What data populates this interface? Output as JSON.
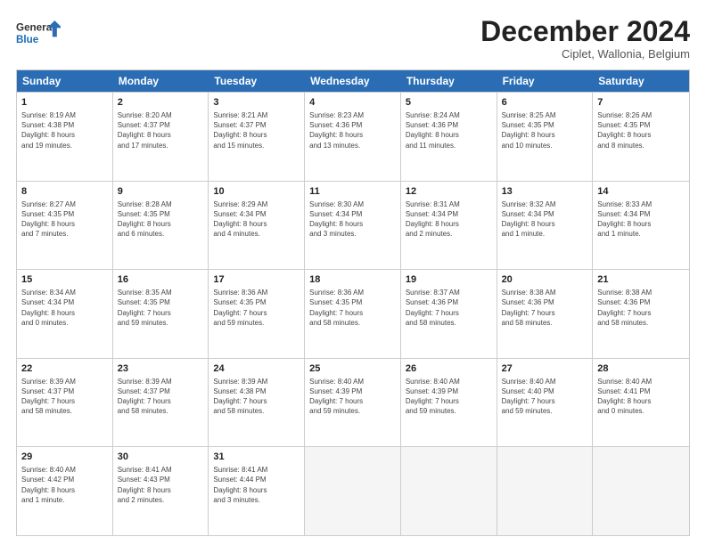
{
  "logo": {
    "line1": "General",
    "line2": "Blue"
  },
  "header": {
    "title": "December 2024",
    "subtitle": "Ciplet, Wallonia, Belgium"
  },
  "days": [
    "Sunday",
    "Monday",
    "Tuesday",
    "Wednesday",
    "Thursday",
    "Friday",
    "Saturday"
  ],
  "weeks": [
    [
      {
        "day": "1",
        "info": "Sunrise: 8:19 AM\nSunset: 4:38 PM\nDaylight: 8 hours\nand 19 minutes."
      },
      {
        "day": "2",
        "info": "Sunrise: 8:20 AM\nSunset: 4:37 PM\nDaylight: 8 hours\nand 17 minutes."
      },
      {
        "day": "3",
        "info": "Sunrise: 8:21 AM\nSunset: 4:37 PM\nDaylight: 8 hours\nand 15 minutes."
      },
      {
        "day": "4",
        "info": "Sunrise: 8:23 AM\nSunset: 4:36 PM\nDaylight: 8 hours\nand 13 minutes."
      },
      {
        "day": "5",
        "info": "Sunrise: 8:24 AM\nSunset: 4:36 PM\nDaylight: 8 hours\nand 11 minutes."
      },
      {
        "day": "6",
        "info": "Sunrise: 8:25 AM\nSunset: 4:35 PM\nDaylight: 8 hours\nand 10 minutes."
      },
      {
        "day": "7",
        "info": "Sunrise: 8:26 AM\nSunset: 4:35 PM\nDaylight: 8 hours\nand 8 minutes."
      }
    ],
    [
      {
        "day": "8",
        "info": "Sunrise: 8:27 AM\nSunset: 4:35 PM\nDaylight: 8 hours\nand 7 minutes."
      },
      {
        "day": "9",
        "info": "Sunrise: 8:28 AM\nSunset: 4:35 PM\nDaylight: 8 hours\nand 6 minutes."
      },
      {
        "day": "10",
        "info": "Sunrise: 8:29 AM\nSunset: 4:34 PM\nDaylight: 8 hours\nand 4 minutes."
      },
      {
        "day": "11",
        "info": "Sunrise: 8:30 AM\nSunset: 4:34 PM\nDaylight: 8 hours\nand 3 minutes."
      },
      {
        "day": "12",
        "info": "Sunrise: 8:31 AM\nSunset: 4:34 PM\nDaylight: 8 hours\nand 2 minutes."
      },
      {
        "day": "13",
        "info": "Sunrise: 8:32 AM\nSunset: 4:34 PM\nDaylight: 8 hours\nand 1 minute."
      },
      {
        "day": "14",
        "info": "Sunrise: 8:33 AM\nSunset: 4:34 PM\nDaylight: 8 hours\nand 1 minute."
      }
    ],
    [
      {
        "day": "15",
        "info": "Sunrise: 8:34 AM\nSunset: 4:34 PM\nDaylight: 8 hours\nand 0 minutes."
      },
      {
        "day": "16",
        "info": "Sunrise: 8:35 AM\nSunset: 4:35 PM\nDaylight: 7 hours\nand 59 minutes."
      },
      {
        "day": "17",
        "info": "Sunrise: 8:36 AM\nSunset: 4:35 PM\nDaylight: 7 hours\nand 59 minutes."
      },
      {
        "day": "18",
        "info": "Sunrise: 8:36 AM\nSunset: 4:35 PM\nDaylight: 7 hours\nand 58 minutes."
      },
      {
        "day": "19",
        "info": "Sunrise: 8:37 AM\nSunset: 4:36 PM\nDaylight: 7 hours\nand 58 minutes."
      },
      {
        "day": "20",
        "info": "Sunrise: 8:38 AM\nSunset: 4:36 PM\nDaylight: 7 hours\nand 58 minutes."
      },
      {
        "day": "21",
        "info": "Sunrise: 8:38 AM\nSunset: 4:36 PM\nDaylight: 7 hours\nand 58 minutes."
      }
    ],
    [
      {
        "day": "22",
        "info": "Sunrise: 8:39 AM\nSunset: 4:37 PM\nDaylight: 7 hours\nand 58 minutes."
      },
      {
        "day": "23",
        "info": "Sunrise: 8:39 AM\nSunset: 4:37 PM\nDaylight: 7 hours\nand 58 minutes."
      },
      {
        "day": "24",
        "info": "Sunrise: 8:39 AM\nSunset: 4:38 PM\nDaylight: 7 hours\nand 58 minutes."
      },
      {
        "day": "25",
        "info": "Sunrise: 8:40 AM\nSunset: 4:39 PM\nDaylight: 7 hours\nand 59 minutes."
      },
      {
        "day": "26",
        "info": "Sunrise: 8:40 AM\nSunset: 4:39 PM\nDaylight: 7 hours\nand 59 minutes."
      },
      {
        "day": "27",
        "info": "Sunrise: 8:40 AM\nSunset: 4:40 PM\nDaylight: 7 hours\nand 59 minutes."
      },
      {
        "day": "28",
        "info": "Sunrise: 8:40 AM\nSunset: 4:41 PM\nDaylight: 8 hours\nand 0 minutes."
      }
    ],
    [
      {
        "day": "29",
        "info": "Sunrise: 8:40 AM\nSunset: 4:42 PM\nDaylight: 8 hours\nand 1 minute."
      },
      {
        "day": "30",
        "info": "Sunrise: 8:41 AM\nSunset: 4:43 PM\nDaylight: 8 hours\nand 2 minutes."
      },
      {
        "day": "31",
        "info": "Sunrise: 8:41 AM\nSunset: 4:44 PM\nDaylight: 8 hours\nand 3 minutes."
      },
      {
        "day": "",
        "info": ""
      },
      {
        "day": "",
        "info": ""
      },
      {
        "day": "",
        "info": ""
      },
      {
        "day": "",
        "info": ""
      }
    ]
  ]
}
